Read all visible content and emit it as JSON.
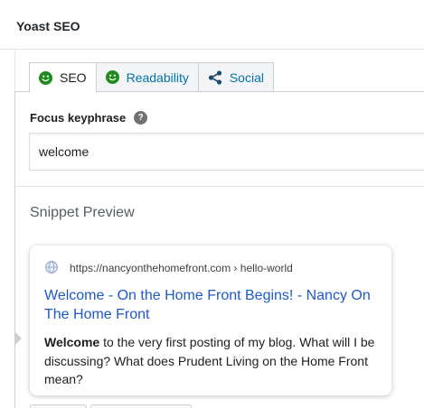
{
  "panel": {
    "title": "Yoast SEO"
  },
  "tabs": [
    {
      "label": "SEO",
      "icon": "smiley-icon",
      "active": true,
      "icon_color": "#1e8a1e"
    },
    {
      "label": "Readability",
      "icon": "smiley-icon",
      "active": false,
      "icon_color": "#1e8a1e"
    },
    {
      "label": "Social",
      "icon": "share-icon",
      "active": false,
      "icon_color": "#0073aa"
    }
  ],
  "focus_keyphrase": {
    "label": "Focus keyphrase",
    "value": "welcome",
    "help_icon": "?"
  },
  "snippet": {
    "heading": "Snippet Preview",
    "url": "https://nancyonthehomefront.com › hello-world",
    "title": "Welcome - On the Home Front Begins! - Nancy On The Home Front",
    "description_keyword": "Welcome",
    "description_rest": " to the very first posting of my blog. What will I be discussing? What does Prudent Living on the Home Front mean?"
  },
  "colors": {
    "link": "#1e59c8",
    "tab_link": "#0073aa",
    "good_indicator": "#1e8a1e"
  }
}
